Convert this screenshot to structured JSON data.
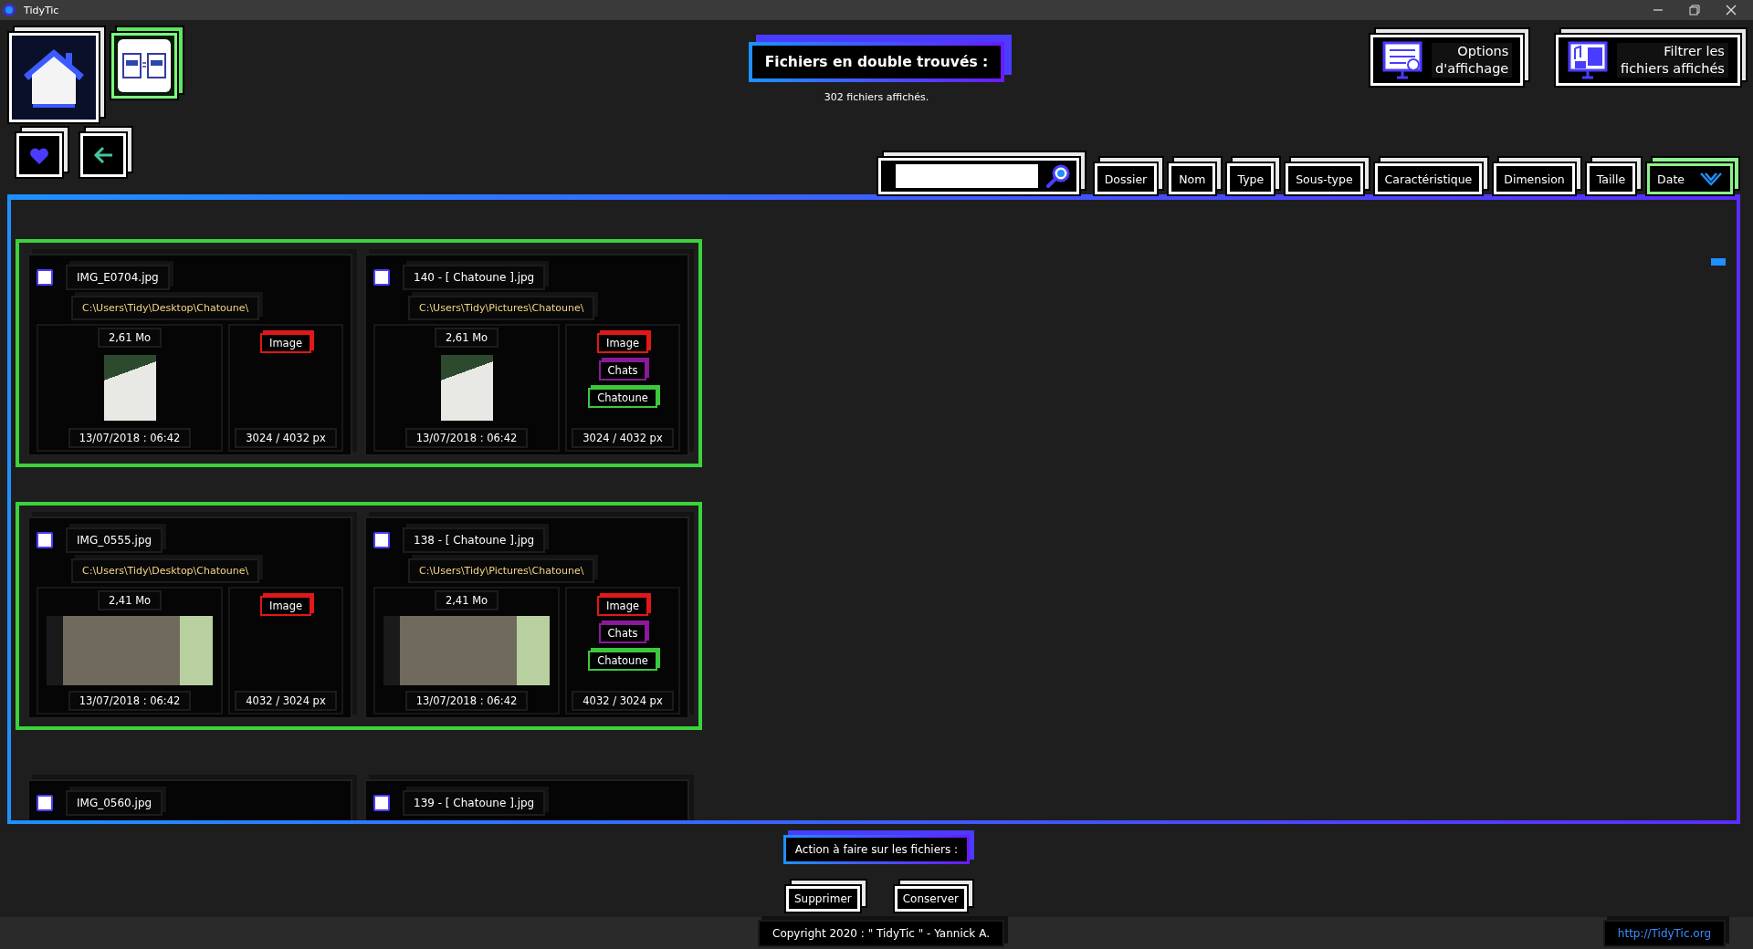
{
  "window": {
    "title": "TidyTic"
  },
  "header": {
    "title": "Fichiers en double trouvés :",
    "subtitle": "302 fichiers affichés."
  },
  "option_buttons": [
    {
      "lines": [
        "Options",
        "d'affichage"
      ]
    },
    {
      "lines": [
        "Filtrer les",
        "fichiers affichés"
      ]
    }
  ],
  "sort_tabs": [
    {
      "label": "Dossier",
      "selected": false
    },
    {
      "label": "Nom",
      "selected": false
    },
    {
      "label": "Type",
      "selected": false
    },
    {
      "label": "Sous-type",
      "selected": false
    },
    {
      "label": "Caractéristique",
      "selected": false
    },
    {
      "label": "Dimension",
      "selected": false
    },
    {
      "label": "Taille",
      "selected": false
    },
    {
      "label": "Date",
      "selected": true
    }
  ],
  "groups": [
    {
      "selected": true,
      "files": [
        {
          "checked": false,
          "name": "IMG_E0704.jpg",
          "path": "C:\\Users\\Tidy\\Desktop\\Chatoune\\",
          "size": "2,61 Mo",
          "landscape": false,
          "date": "13/07/2018 : 06:42",
          "dimensions": "3024 / 4032 px",
          "tags": [
            {
              "label": "Image",
              "color": "#e01818"
            }
          ]
        },
        {
          "checked": false,
          "name": "140 - [ Chatoune ].jpg",
          "path": "C:\\Users\\Tidy\\Pictures\\Chatoune\\",
          "size": "2,61 Mo",
          "landscape": false,
          "date": "13/07/2018 : 06:42",
          "dimensions": "3024 / 4032 px",
          "tags": [
            {
              "label": "Image",
              "color": "#e01818"
            },
            {
              "label": "Chats",
              "color": "#8a1a9a"
            },
            {
              "label": "Chatoune",
              "color": "#3cc83c"
            }
          ]
        }
      ]
    },
    {
      "selected": true,
      "files": [
        {
          "checked": false,
          "name": "IMG_0555.jpg",
          "path": "C:\\Users\\Tidy\\Desktop\\Chatoune\\",
          "size": "2,41 Mo",
          "landscape": true,
          "date": "13/07/2018 : 06:42",
          "dimensions": "4032 / 3024 px",
          "tags": [
            {
              "label": "Image",
              "color": "#e01818"
            }
          ]
        },
        {
          "checked": false,
          "name": "138 - [ Chatoune ].jpg",
          "path": "C:\\Users\\Tidy\\Pictures\\Chatoune\\",
          "size": "2,41 Mo",
          "landscape": true,
          "date": "13/07/2018 : 06:42",
          "dimensions": "4032 / 3024 px",
          "tags": [
            {
              "label": "Image",
              "color": "#e01818"
            },
            {
              "label": "Chats",
              "color": "#8a1a9a"
            },
            {
              "label": "Chatoune",
              "color": "#3cc83c"
            }
          ]
        }
      ]
    },
    {
      "selected": false,
      "files": [
        {
          "checked": false,
          "name": "IMG_0560.jpg"
        },
        {
          "checked": false,
          "name": "139 - [ Chatoune ].jpg"
        }
      ]
    }
  ],
  "actions": {
    "title": "Action à faire sur les fichiers :",
    "buttons": [
      "Supprimer",
      "Conserver"
    ]
  },
  "footer": {
    "copyright": "Copyright 2020 : \" TidyTic \" - Yannick A.",
    "link": "http://TidyTic.org"
  }
}
